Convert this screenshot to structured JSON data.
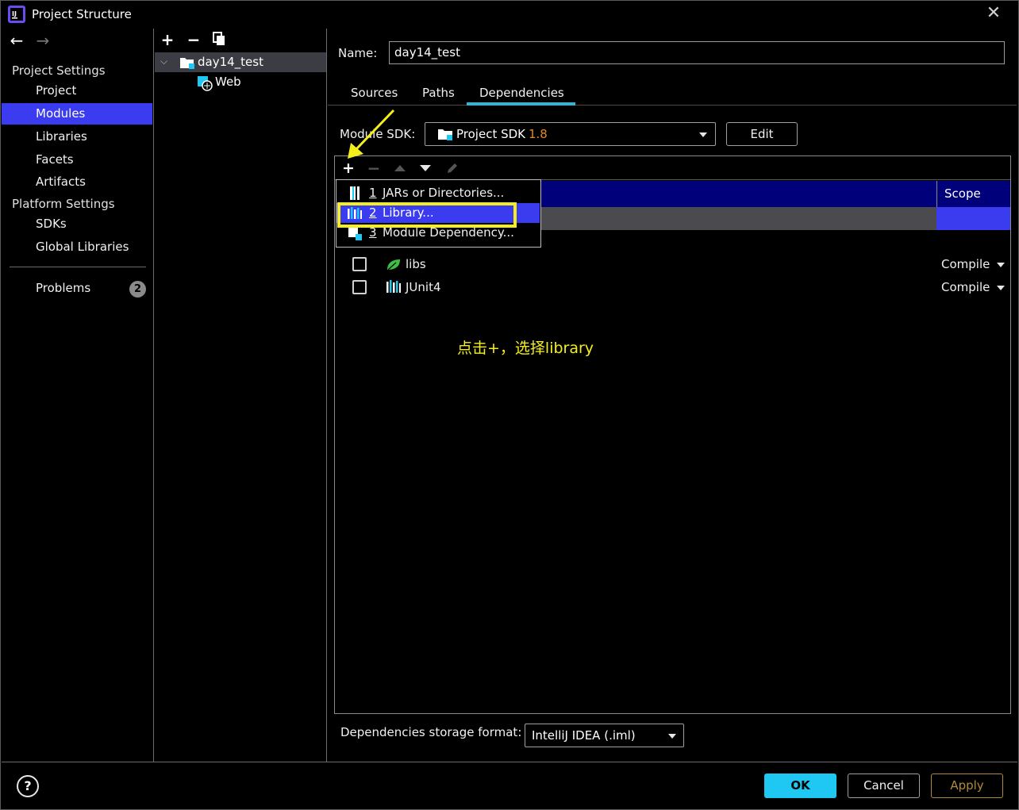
{
  "window": {
    "title": "Project Structure"
  },
  "nav": {
    "project_settings_label": "Project Settings",
    "items_project": [
      {
        "label": "Project",
        "selected": false
      },
      {
        "label": "Modules",
        "selected": true
      },
      {
        "label": "Libraries",
        "selected": false
      },
      {
        "label": "Facets",
        "selected": false
      },
      {
        "label": "Artifacts",
        "selected": false
      }
    ],
    "platform_settings_label": "Platform Settings",
    "items_platform": [
      {
        "label": "SDKs"
      },
      {
        "label": "Global Libraries"
      }
    ],
    "problems": {
      "label": "Problems",
      "count": "2"
    }
  },
  "tree": {
    "module": "day14_test",
    "facet": "Web"
  },
  "module": {
    "name_label": "Name:",
    "name_value": "day14_test",
    "tabs": [
      "Sources",
      "Paths",
      "Dependencies"
    ],
    "active_tab": "Dependencies",
    "sdk_label": "Module SDK:",
    "sdk_value": "Project SDK",
    "sdk_version": "1.8",
    "edit_button": "Edit"
  },
  "dependencies": {
    "scope_header": "Scope",
    "rows": [
      {
        "name": "libs",
        "scope": "Compile",
        "icon": "leaf-icon"
      },
      {
        "name": "JUnit4",
        "scope": "Compile",
        "icon": "library-icon"
      }
    ],
    "storage_label": "Dependencies storage format:",
    "storage_value": "IntelliJ IDEA (.iml)"
  },
  "popup": {
    "items": [
      {
        "num": "1",
        "label": "JARs or Directories...",
        "icon": "jar-icon"
      },
      {
        "num": "2",
        "label": "Library...",
        "icon": "library-icon"
      },
      {
        "num": "3",
        "label": "Module Dependency...",
        "icon": "module-icon"
      }
    ]
  },
  "annotation": "点击+，选择library",
  "footer": {
    "ok": "OK",
    "cancel": "Cancel",
    "apply": "Apply",
    "help": "?"
  },
  "colors": {
    "accent_blue": "#3b3bf0",
    "ok_cyan": "#1ec8f2",
    "highlight_yellow": "#f4ef1c",
    "sdk_version_orange": "#e08a2a"
  }
}
